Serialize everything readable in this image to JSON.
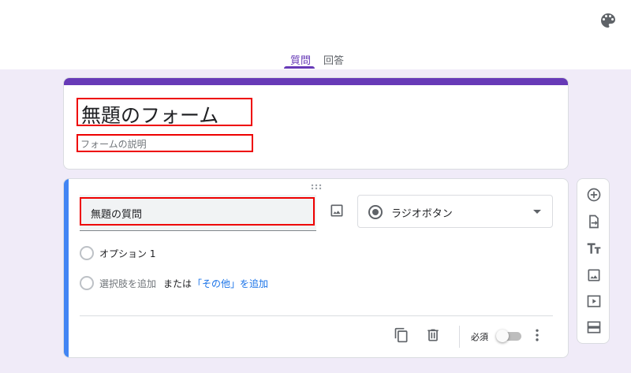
{
  "colors": {
    "accent": "#673ab7",
    "question_accent": "#4285f4",
    "link": "#1a73e8",
    "annotation": "#ee0000",
    "background": "#f0ebf8"
  },
  "header": {
    "palette_icon": "palette-icon",
    "tabs": [
      {
        "label": "質問",
        "active": true
      },
      {
        "label": "回答",
        "active": false
      }
    ]
  },
  "form": {
    "title": "無題のフォーム",
    "description_placeholder": "フォームの説明"
  },
  "question": {
    "title": "無題の質問",
    "image_icon": "image-icon",
    "type": {
      "icon": "radio-button-icon",
      "label": "ラジオボタン"
    },
    "options": [
      {
        "label": "オプション 1"
      }
    ],
    "add_option": {
      "label": "選択肢を追加",
      "or": "または",
      "add_other": "「その他」を追加"
    },
    "footer": {
      "copy_icon": "copy-icon",
      "delete_icon": "delete-icon",
      "required_label": "必須",
      "required": false,
      "more_icon": "more-vert-icon"
    }
  },
  "side_toolbar": {
    "items": [
      "add-question-icon",
      "import-questions-icon",
      "title-text-icon",
      "add-image-icon",
      "add-video-icon",
      "add-section-icon"
    ]
  }
}
